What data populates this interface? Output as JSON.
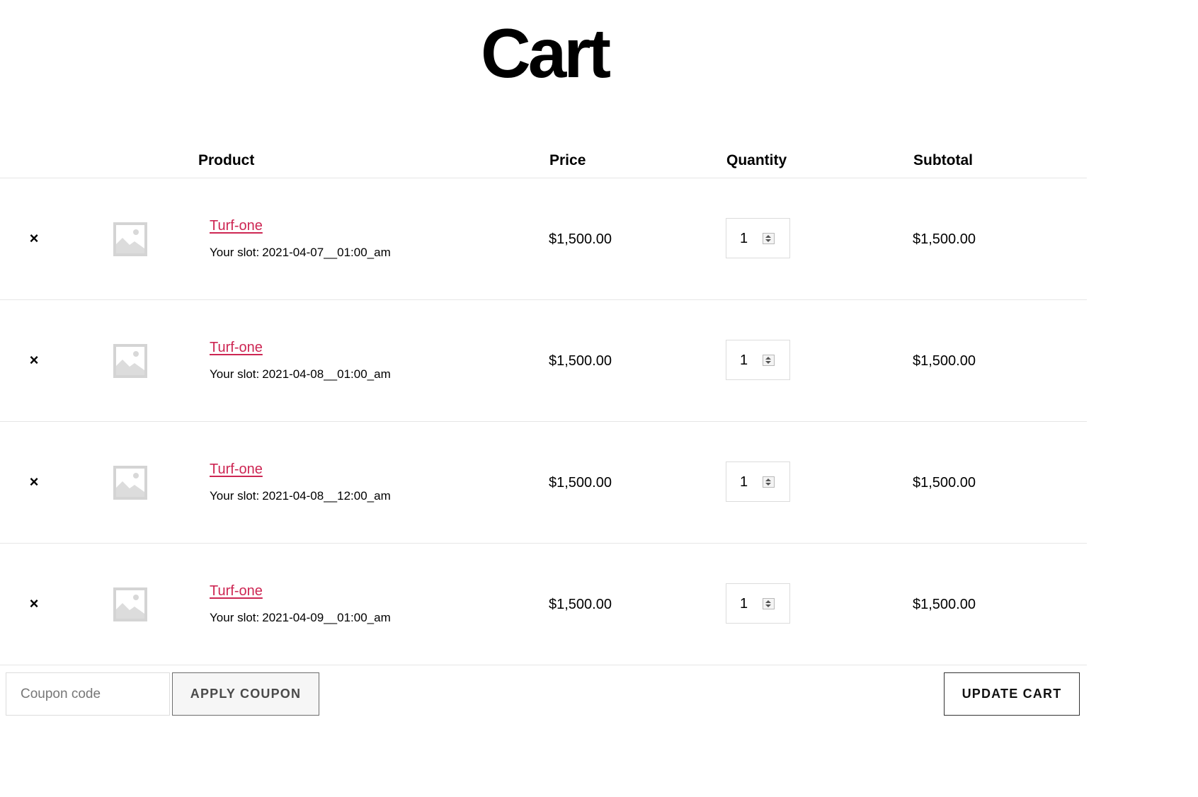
{
  "page": {
    "title": "Cart"
  },
  "table": {
    "headers": {
      "product": "Product",
      "price": "Price",
      "quantity": "Quantity",
      "subtotal": "Subtotal"
    },
    "rows": [
      {
        "remove": "×",
        "name": "Turf-one",
        "meta_label": "Your slot:",
        "meta_value": "2021-04-07__01:00_am",
        "price": "$1,500.00",
        "quantity": "1",
        "subtotal": "$1,500.00"
      },
      {
        "remove": "×",
        "name": "Turf-one",
        "meta_label": "Your slot:",
        "meta_value": "2021-04-08__01:00_am",
        "price": "$1,500.00",
        "quantity": "1",
        "subtotal": "$1,500.00"
      },
      {
        "remove": "×",
        "name": "Turf-one",
        "meta_label": "Your slot:",
        "meta_value": "2021-04-08__12:00_am",
        "price": "$1,500.00",
        "quantity": "1",
        "subtotal": "$1,500.00"
      },
      {
        "remove": "×",
        "name": "Turf-one",
        "meta_label": "Your slot:",
        "meta_value": "2021-04-09__01:00_am",
        "price": "$1,500.00",
        "quantity": "1",
        "subtotal": "$1,500.00"
      }
    ]
  },
  "actions": {
    "coupon_placeholder": "Coupon code",
    "apply_label": "APPLY COUPON",
    "update_label": "UPDATE CART"
  },
  "colors": {
    "link": "#cd2653",
    "border": "#e6e6e6"
  },
  "icons": {
    "remove": "close-icon",
    "thumbnail": "image-placeholder-icon",
    "spinner": "spinner-icon"
  }
}
